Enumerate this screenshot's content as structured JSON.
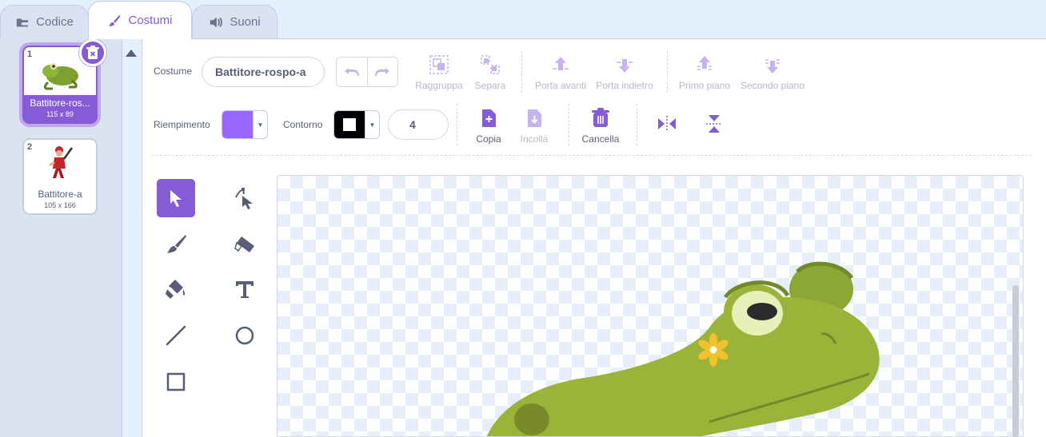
{
  "tabs": [
    {
      "label": "Codice",
      "icon": "code-icon"
    },
    {
      "label": "Costumi",
      "icon": "brush-icon",
      "active": true
    },
    {
      "label": "Suoni",
      "icon": "speaker-icon"
    }
  ],
  "costumes": [
    {
      "number": "1",
      "name": "Battitore-ros...",
      "size": "115 x 89",
      "selected": true
    },
    {
      "number": "2",
      "name": "Battitore-a",
      "size": "105 x 166",
      "selected": false
    }
  ],
  "toolbar": {
    "costume_label": "Costume",
    "costume_name": "Battitore-rospo-a",
    "group_label": "Raggruppa",
    "ungroup_label": "Separa",
    "forward_label": "Porta avanti",
    "backward_label": "Porta indietro",
    "front_label": "Primo piano",
    "back_label": "Secondo piano",
    "fill_label": "Riempimento",
    "outline_label": "Contorno",
    "outline_width": "4",
    "copy_label": "Copia",
    "paste_label": "Incolla",
    "delete_label": "Cancella"
  },
  "colors": {
    "accent": "#855cd6",
    "fill": "#9966ff",
    "outline": "#000000",
    "frog": "#9cb33a",
    "frog_dark": "#6f8a26"
  },
  "tools": [
    "select-tool",
    "reshape-tool",
    "brush-tool",
    "eraser-tool",
    "fill-tool",
    "text-tool",
    "line-tool",
    "circle-tool",
    "rectangle-tool"
  ]
}
